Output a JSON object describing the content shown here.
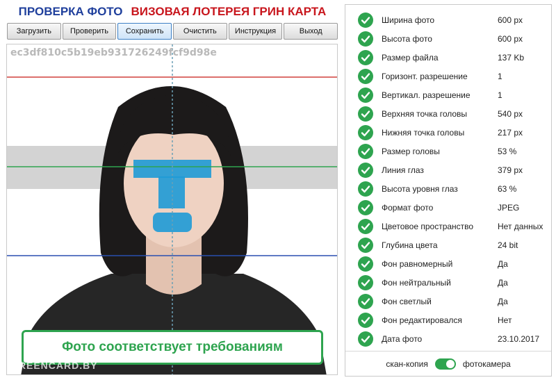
{
  "header": {
    "title_check": "ПРОВЕРКА ФОТО",
    "title_lottery": "ВИЗОВАЯ ЛОТЕРЕЯ ГРИН КАРТА"
  },
  "toolbar": {
    "load": "Загрузить",
    "check": "Проверить",
    "save": "Сохранить",
    "clear": "Очистить",
    "instructions": "Инструкция",
    "exit": "Выход"
  },
  "photo": {
    "hash": "ec3df810c5b19eb931726249fcf9d98e",
    "status": "Фото соответствует требованиям",
    "watermark": "GREENCARD.BY"
  },
  "results": [
    {
      "label": "Ширина фото",
      "value": "600 px"
    },
    {
      "label": "Высота фото",
      "value": "600 px"
    },
    {
      "label": "Размер файла",
      "value": "137 Kb"
    },
    {
      "label": "Горизонт. разрешение",
      "value": "1"
    },
    {
      "label": "Вертикал. разрешение",
      "value": "1"
    },
    {
      "label": "Верхняя точка головы",
      "value": "540 px"
    },
    {
      "label": "Нижняя точка головы",
      "value": "217 px"
    },
    {
      "label": "Размер головы",
      "value": "53 %"
    },
    {
      "label": "Линия глаз",
      "value": "379 px"
    },
    {
      "label": "Высота уровня глаз",
      "value": "63 %"
    },
    {
      "label": "Формат фото",
      "value": "JPEG"
    },
    {
      "label": "Цветовое пространство",
      "value": "Нет данных"
    },
    {
      "label": "Глубина цвета",
      "value": "24 bit"
    },
    {
      "label": "Фон равномерный",
      "value": "Да"
    },
    {
      "label": "Фон нейтральный",
      "value": "Да"
    },
    {
      "label": "Фон светлый",
      "value": "Да"
    },
    {
      "label": "Фон редактировался",
      "value": "Нет"
    },
    {
      "label": "Дата фото",
      "value": "23.10.2017"
    }
  ],
  "mode": {
    "scan_label": "скан-копия",
    "camera_label": "фотокамера",
    "camera_selected": true
  },
  "colors": {
    "success": "#2ea44f",
    "title_blue": "#1f3f9c",
    "title_red": "#c8161d"
  }
}
